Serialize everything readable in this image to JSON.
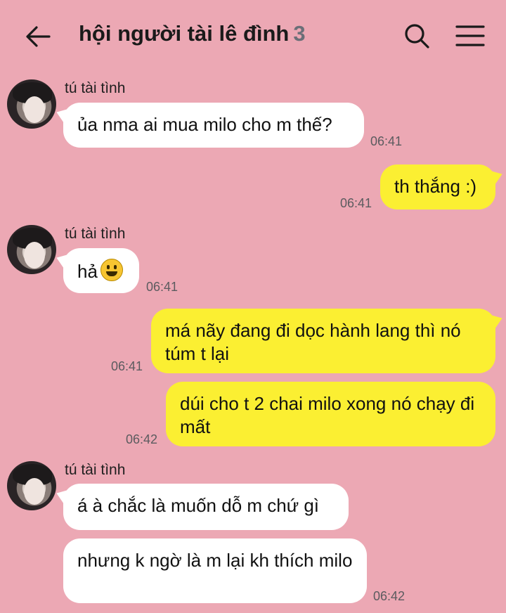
{
  "header": {
    "title": "hội người tài lê đình",
    "member_count": "3"
  },
  "messages": [
    {
      "sender": "tú tài tình",
      "text": "ủa nma ai mua milo cho m thế?",
      "time": "06:41",
      "direction": "in"
    },
    {
      "text": "th thắng :)",
      "time": "06:41",
      "direction": "out"
    },
    {
      "sender": "tú tài tình",
      "text": "hả",
      "emoji": "grinning-face",
      "time": "06:41",
      "direction": "in"
    },
    {
      "text": "má nãy đang đi dọc hành lang thì nó túm t lại",
      "time": "06:41",
      "direction": "out"
    },
    {
      "text": "dúi cho t 2 chai milo xong nó chạy đi mất",
      "time": "06:42",
      "direction": "out"
    },
    {
      "sender": "tú tài tình",
      "text": "á à chắc là muốn dỗ m chứ gì",
      "direction": "in"
    },
    {
      "text": "nhưng k ngờ là m lại kh thích milo",
      "time": "06:42",
      "direction": "in"
    }
  ],
  "colors": {
    "background": "#eca8b4",
    "incoming_bubble": "#ffffff",
    "outgoing_bubble": "#fbef32"
  },
  "icons": [
    "back-arrow-icon",
    "search-icon",
    "menu-icon"
  ]
}
